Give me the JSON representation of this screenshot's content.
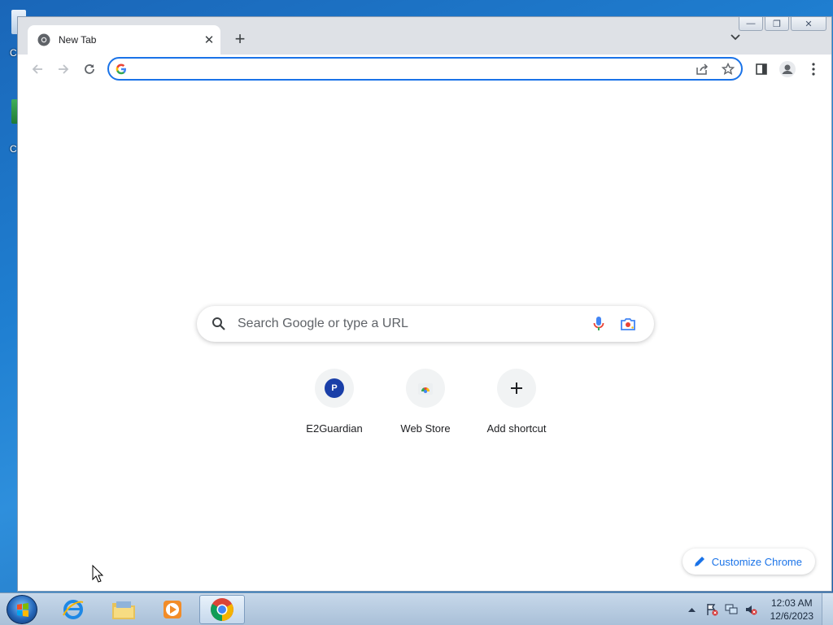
{
  "desktop": {
    "icon_labels": [
      "C",
      "C"
    ]
  },
  "tab": {
    "title": "New Tab"
  },
  "window_controls": {
    "minimize": "—",
    "restore": "❐",
    "close": "✕"
  },
  "omnibox": {
    "value": "",
    "placeholder": ""
  },
  "ntp": {
    "search_placeholder": "Search Google or type a URL",
    "shortcuts": [
      {
        "label": "E2Guardian",
        "icon": "P"
      },
      {
        "label": "Web Store",
        "icon": "chrome-web-store-icon"
      },
      {
        "label": "Add shortcut",
        "icon": "plus-icon"
      }
    ],
    "customize_label": "Customize Chrome"
  },
  "taskbar": {
    "time": "12:03 AM",
    "date": "12/6/2023"
  },
  "colors": {
    "accent": "#1a73e8",
    "frame": "#dee1e6",
    "text": "#202124"
  }
}
